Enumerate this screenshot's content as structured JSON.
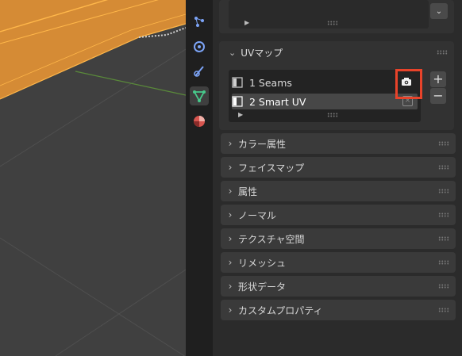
{
  "uv_panel": {
    "title": "UVマップ",
    "maps": [
      {
        "label": "1 Seams",
        "active_render": true
      },
      {
        "label": "2 Smart UV",
        "active_render": false
      }
    ],
    "add_label": "+",
    "remove_label": "−"
  },
  "collapsed_panels": [
    {
      "label": "カラー属性"
    },
    {
      "label": "フェイスマップ"
    },
    {
      "label": "属性"
    },
    {
      "label": "ノーマル"
    },
    {
      "label": "テクスチャ空間"
    },
    {
      "label": "リメッシュ"
    },
    {
      "label": "形状データ"
    },
    {
      "label": "カスタムプロパティ"
    }
  ],
  "colors": {
    "mesh_orange": "#d58b35",
    "highlight_red": "#e8432a",
    "active_tab_green": "#47c98b"
  }
}
